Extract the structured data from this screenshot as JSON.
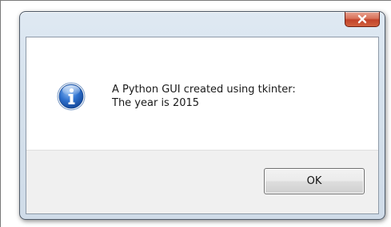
{
  "dialog": {
    "title": "",
    "message_lines": [
      "A Python GUI created using tkinter:",
      "The year is 2015"
    ],
    "icon": "information-icon",
    "ok_label": "OK",
    "close_icon": "close-icon"
  },
  "colors": {
    "close_button": "#c7472d",
    "icon_blue": "#1f5fbf",
    "frame_border": "#4f5a68",
    "button_area": "#f0f0f0"
  }
}
